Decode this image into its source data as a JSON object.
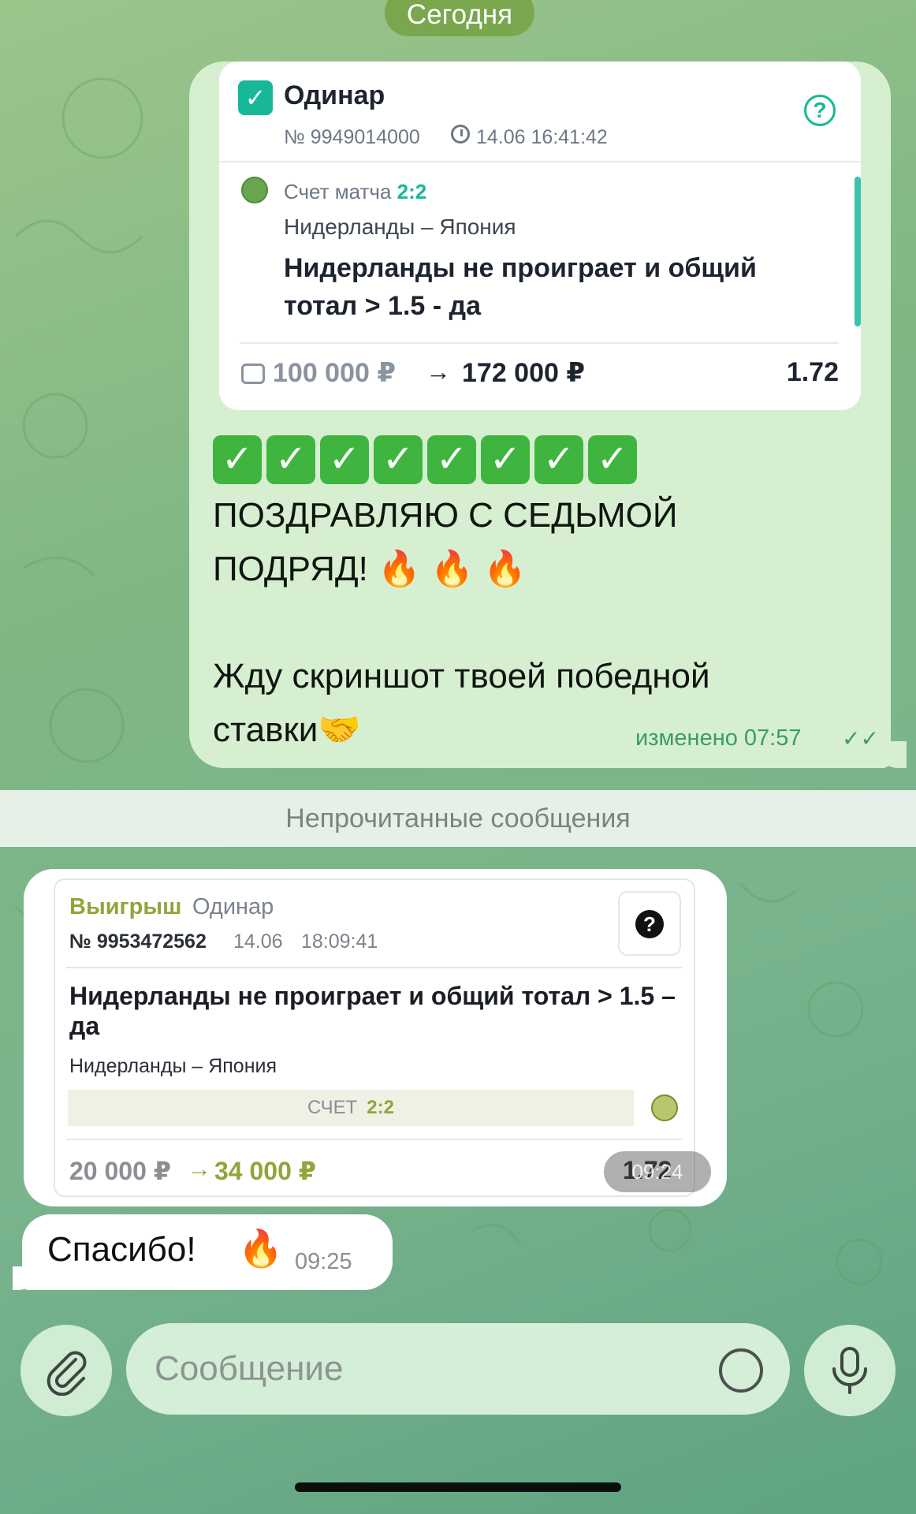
{
  "date_separator": "Сегодня",
  "bet_card": {
    "title": "Одинар",
    "number": "№ 9949014000",
    "datetime": "14.06 16:41:42",
    "score_label": "Счет матча",
    "score": "2:2",
    "teams": "Нидерланды – Япония",
    "selection": "Нидерланды не проиграет и общий тотал > 1.5 - да",
    "stake": "100 000 ₽",
    "arrow": "→",
    "payout": "172 000 ₽",
    "odds": "1.72"
  },
  "message": {
    "checks": [
      "✓",
      "✓",
      "✓",
      "✓",
      "✓",
      "✓",
      "✓",
      "✓"
    ],
    "line1": "ПОЗДРАВЛЯЮ С СЕДЬМОЙ",
    "line2": "ПОДРЯД!",
    "fire": "🔥 🔥 🔥",
    "line3": "Жду скриншот твоей победной",
    "line4": "ставки🤝",
    "edited": "изменено 07:57",
    "read_marks": "✓✓"
  },
  "unread_divider": "Непрочитанные сообщения",
  "win_card": {
    "status": "Выигрыш",
    "type": "Одинар",
    "number": "№ 9953472562",
    "date": "14.06",
    "time": "18:09:41",
    "help": "?",
    "selection": "Нидерланды не проиграет и общий тотал > 1.5 – да",
    "teams": "Нидерланды – Япония",
    "score_label": "СЧЕТ",
    "score": "2:2",
    "stake": "20 000 ₽",
    "arrow": "→",
    "payout": "34 000 ₽",
    "odds": "1.72",
    "msg_time": "09:24"
  },
  "thanks": {
    "text": "Спасибо!",
    "fire": "🔥",
    "time": "09:25"
  },
  "composer": {
    "placeholder": "Сообщение"
  },
  "colors": {
    "accent_green": "#17b897",
    "win_olive": "#90a53a",
    "out_bubble": "#d6efd0",
    "date_pill": "#7aa74e"
  },
  "icons": {
    "attach": "paperclip-icon",
    "sticker": "sticker-icon",
    "mic": "microphone-icon",
    "help": "question-icon",
    "ball": "soccer-ball-icon"
  }
}
